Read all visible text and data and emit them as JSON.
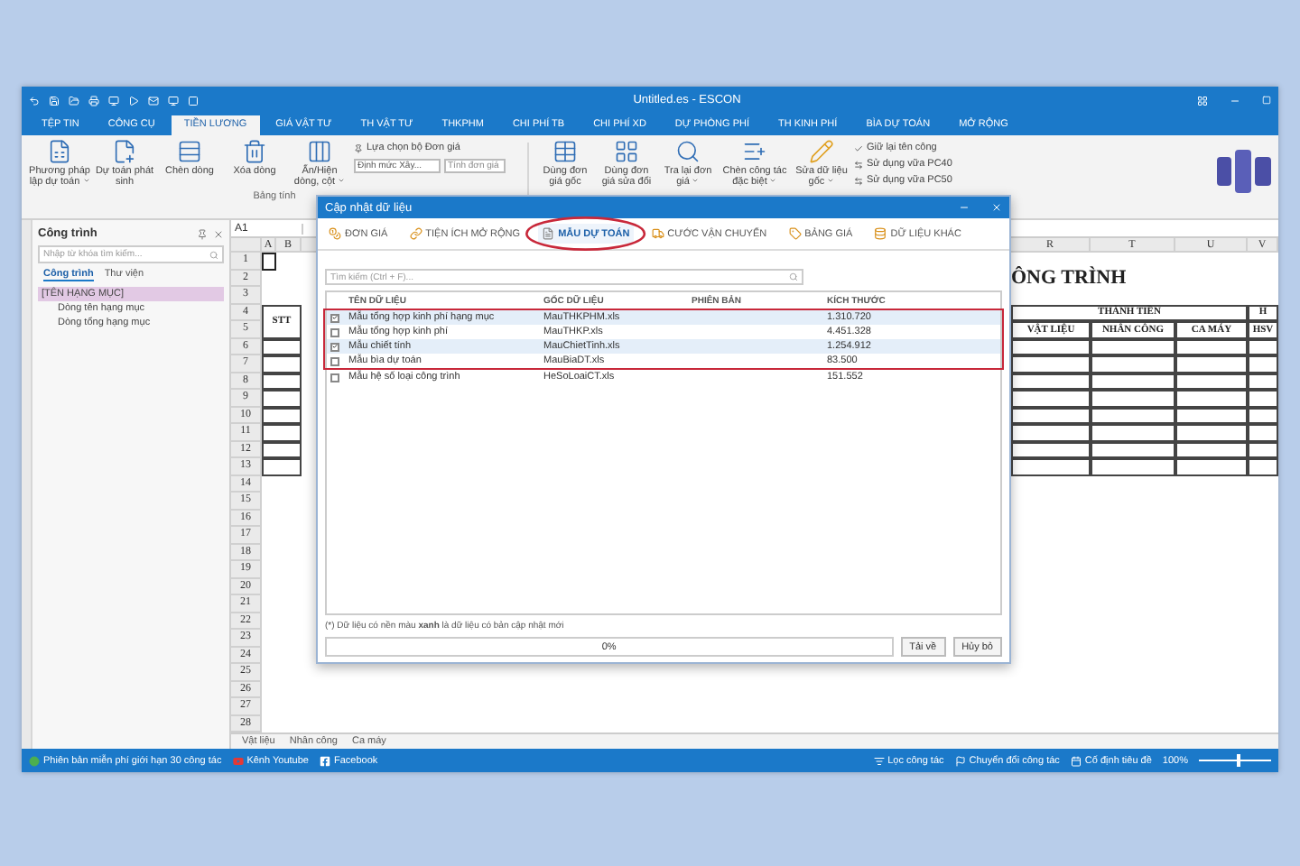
{
  "window": {
    "title": "Untitled.es - ESCON"
  },
  "ribbon_tabs": [
    {
      "label": "TỆP TIN",
      "selected": false
    },
    {
      "label": "CÔNG CỤ",
      "selected": false
    },
    {
      "label": "TIỀN LƯƠNG",
      "selected": true
    },
    {
      "label": "GIÁ VẬT TƯ",
      "selected": false
    },
    {
      "label": "TH VẬT TƯ",
      "selected": false
    },
    {
      "label": "THKPHM",
      "selected": false
    },
    {
      "label": "CHI PHÍ TB",
      "selected": false
    },
    {
      "label": "CHI PHÍ XD",
      "selected": false
    },
    {
      "label": "DỰ PHÒNG PHÍ",
      "selected": false
    },
    {
      "label": "TH KINH PHÍ",
      "selected": false
    },
    {
      "label": "BÌA DỰ TOÁN",
      "selected": false
    },
    {
      "label": "MỞ RỘNG",
      "selected": false
    }
  ],
  "ribbon": {
    "left_buttons": [
      {
        "label": "Phương pháp lập dự toán",
        "dropdown": true
      },
      {
        "label": "Dự toán phát sinh",
        "dropdown": false
      },
      {
        "label": "Chèn dòng",
        "dropdown": false
      },
      {
        "label": "Xóa dòng",
        "dropdown": false
      },
      {
        "label": "Ẩn/Hiện dòng, cột",
        "dropdown": true
      }
    ],
    "price_set": {
      "label": "Lựa chọn bộ Đơn giá",
      "combo": "Định mức Xây...",
      "field": "Tính đơn giá"
    },
    "group_label": "Bảng tính",
    "right_buttons": [
      {
        "label": "Dùng đơn giá gốc",
        "dropdown": false
      },
      {
        "label": "Dùng đơn giá sửa đổi",
        "dropdown": false
      },
      {
        "label": "Tra lại đơn giá",
        "dropdown": true
      },
      {
        "label": "Chèn công tác đặc biệt",
        "dropdown": true
      },
      {
        "label": "Sửa dữ liệu gốc",
        "dropdown": true
      }
    ],
    "options": [
      "Giữ lại tên công",
      "Sử dụng vữa PC40",
      "Sử dụng vữa PC50"
    ]
  },
  "project_panel": {
    "title": "Công trình",
    "search": {
      "placeholder": "Nhập từ khóa tìm kiếm..."
    },
    "tabs": [
      {
        "label": "Công trình",
        "selected": true
      },
      {
        "label": "Thư viện",
        "selected": false
      }
    ],
    "tree": [
      {
        "label": "[TÊN HẠNG MỤC]",
        "selected": true,
        "children": [
          {
            "label": "Dòng tên hạng mục",
            "selected": false
          },
          {
            "label": "Dòng tổng hạng mục",
            "selected": false
          }
        ]
      }
    ]
  },
  "sheet": {
    "cell_ref": "A1",
    "columns": [
      "A",
      "B",
      "R",
      "T",
      "U",
      "V"
    ],
    "row_numbers": [
      "1",
      "2",
      "3",
      "4",
      "5",
      "6",
      "7",
      "8",
      "9",
      "10",
      "11",
      "12",
      "13",
      "14",
      "15",
      "16",
      "17",
      "18",
      "19",
      "20",
      "21",
      "22",
      "23",
      "24",
      "25",
      "26",
      "27",
      "28"
    ],
    "title": "ÔNG TRÌNH",
    "stt": "STT",
    "group_heading": "THÀNH TIỀN",
    "headings": [
      "VẬT LIỆU",
      "NHÂN CÔNG",
      "CA MÁY"
    ],
    "last_top": "H",
    "last_heading": "HSV",
    "tabs": [
      "Vật liệu",
      "Nhân công",
      "Ca máy"
    ]
  },
  "dialog": {
    "title": "Cập nhật dữ liệu",
    "tabs": [
      {
        "label": "ĐƠN GIÁ",
        "selected": false,
        "circled": false
      },
      {
        "label": "TIỆN ÍCH MỞ RỘNG",
        "selected": false,
        "circled": false
      },
      {
        "label": "MẪU DỰ TOÁN",
        "selected": true,
        "circled": true
      },
      {
        "label": "CƯỚC VẬN CHUYỂN",
        "selected": false,
        "circled": false
      },
      {
        "label": "BẢNG GIÁ",
        "selected": false,
        "circled": false
      },
      {
        "label": "DỮ LIỆU KHÁC",
        "selected": false,
        "circled": false
      }
    ],
    "search": {
      "placeholder": "Tìm kiếm (Ctrl + F)..."
    },
    "columns": [
      "TÊN DỮ LIỆU",
      "GỐC DỮ LIỆU",
      "PHIÊN BẢN",
      "KÍCH THƯỚC"
    ],
    "rows": [
      {
        "name": "Mẫu tổng hợp kinh phí hạng mục",
        "file": "MauTHKPHM.xls",
        "size": "1.310.720",
        "checked": true,
        "highlighted": true,
        "framed": true
      },
      {
        "name": "Mẫu tổng hợp kinh phí",
        "file": "MauTHKP.xls",
        "size": "4.451.328",
        "checked": false,
        "highlighted": false,
        "framed": true
      },
      {
        "name": "Mẫu chiết tính",
        "file": "MauChietTinh.xls",
        "size": "1.254.912",
        "checked": true,
        "highlighted": true,
        "framed": true
      },
      {
        "name": "Mẫu bìa dự toán",
        "file": "MauBiaDT.xls",
        "size": "83.500",
        "checked": false,
        "highlighted": false,
        "framed": true
      },
      {
        "name": "Mẫu hệ số loại công trình",
        "file": "HeSoLoaiCT.xls",
        "size": "151.552",
        "checked": false,
        "highlighted": false,
        "framed": false
      }
    ],
    "note": "(*) Dữ liệu có nền màu **xanh** là dữ liệu có bản cập nhật mới",
    "progress": {
      "text": "0%",
      "level": 0
    },
    "buttons": [
      "Tải về",
      "Hủy bỏ"
    ]
  },
  "status_bar": {
    "left": [
      {
        "kind": "dot",
        "label": "Phiên bản miễn phí giới hạn 30 công tác"
      },
      {
        "kind": "video",
        "label": "Kênh Youtube"
      },
      {
        "kind": "social",
        "label": "Facebook"
      }
    ],
    "right": [
      {
        "kind": "filter",
        "label": "Lọc công tác"
      },
      {
        "kind": "flag",
        "label": "Chuyển đổi công tác"
      },
      {
        "kind": "calendar",
        "label": "Cố định tiêu đề"
      }
    ],
    "zoom": {
      "text": "100%",
      "level": 0.55
    }
  }
}
